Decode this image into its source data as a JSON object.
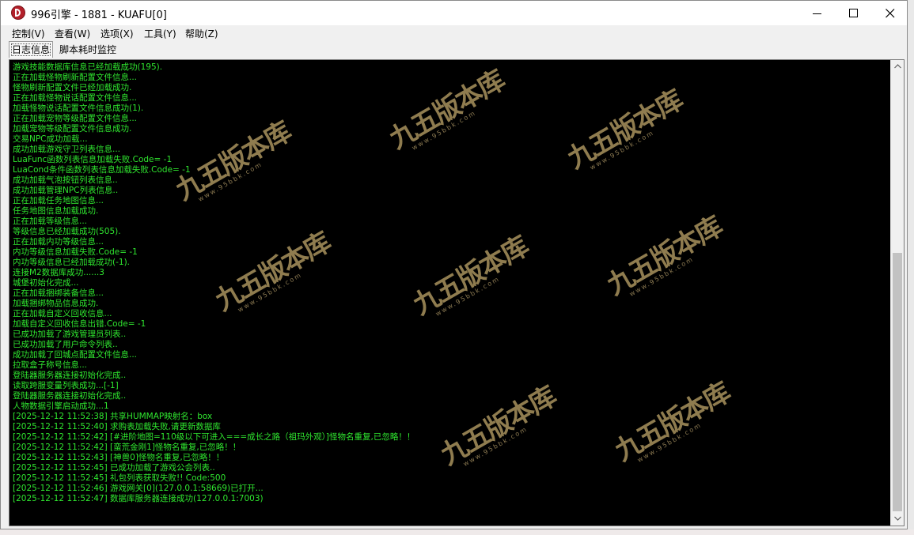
{
  "window": {
    "title": "996引擎 - 1881 - KUAFU[0]"
  },
  "menu": [
    {
      "label": "控制(V)"
    },
    {
      "label": "查看(W)"
    },
    {
      "label": "选项(X)"
    },
    {
      "label": "工具(Y)"
    },
    {
      "label": "帮助(Z)"
    }
  ],
  "tabs": [
    {
      "label": "日志信息",
      "active": true
    },
    {
      "label": "脚本耗时监控",
      "active": false
    }
  ],
  "log": {
    "text_color": "#2fe62f",
    "background_color": "#000000",
    "lines": [
      "游戏技能数据库信息已经加载成功(195).",
      "正在加载怪物刷新配置文件信息...",
      "怪物刷新配置文件已经加载成功.",
      "正在加载怪物说话配置文件信息...",
      "加载怪物说话配置文件信息成功(1).",
      "正在加载宠物等级配置文件信息...",
      "加载宠物等级配置文件信息成功.",
      "交易NPC成功加载...",
      "成功加载游戏守卫列表信息...",
      "LuaFunc函数列表信息加载失败.Code= -1",
      "LuaCond条件函数列表信息加载失败.Code= -1",
      "成功加载气泡按钮列表信息..",
      "成功加载管理NPC列表信息..",
      "正在加载任务地图信息...",
      "任务地图信息加载成功.",
      "正在加载等级信息...",
      "等级信息已经加载成功(505).",
      "正在加载内功等级信息...",
      "内功等级信息加载失败.Code= -1",
      "内功等级信息已经加载成功(-1).",
      "连接M2数据库成功......3",
      "城堡初始化完成...",
      "正在加载捆绑装备信息...",
      "加载捆绑物品信息成功.",
      "正在加载自定义回收信息...",
      "加载自定义回收信息出错.Code= -1",
      "已成功加载了游戏管理员列表..",
      "已成功加载了用户命令列表..",
      "成功加载了回城点配置文件信息...",
      "拉取盒子称号信息...",
      "登陆器服务器连接初始化完成..",
      "读取跨服变量列表成功...[-1]",
      "登陆器服务器连接初始化完成..",
      "人物数据引擎启动成功...1",
      "[2025-12-12 11:52:38] 共享HUMMAP映射名：box",
      "[2025-12-12 11:52:40] 求购表加载失败,请更新数据库",
      "[2025-12-12 11:52:42] [#进阶地图=110级以下可进入===成长之路（祖玛外观）]怪物名重复,已忽略！！",
      "[2025-12-12 11:52:42] [蛮荒金刚1]怪物名重复,已忽略！！",
      "[2025-12-12 11:52:43] [神兽0]怪物名重复,已忽略！！",
      "[2025-12-12 11:52:45] 已成功加载了游戏公会列表..",
      "[2025-12-12 11:52:45] 礼包列表获取失败!! Code:500",
      "[2025-12-12 11:52:46] 游戏网关[0](127.0.0.1:58669)已打开...",
      "[2025-12-12 11:52:47] 数据库服务器连接成功(127.0.0.1:7003)"
    ]
  },
  "watermark": {
    "text": "九五版本库",
    "subtext": "www.95bbk.com"
  }
}
